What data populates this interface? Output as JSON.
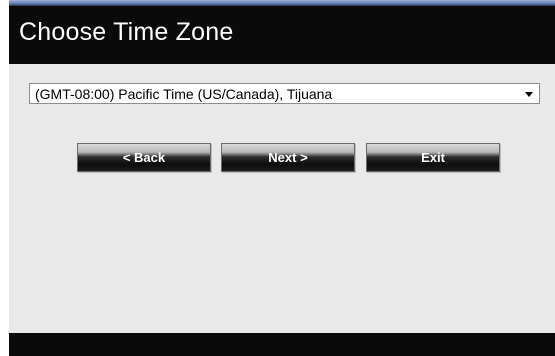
{
  "header": {
    "title": "Choose Time Zone"
  },
  "form": {
    "timezone_select": {
      "selected": "(GMT-08:00) Pacific Time (US/Canada), Tijuana"
    }
  },
  "buttons": {
    "back": "< Back",
    "next": "Next >",
    "exit": "Exit"
  },
  "colors": {
    "frame": "#0a0a0a",
    "panel": "#e9e9ea",
    "title_text": "#ffffff"
  }
}
